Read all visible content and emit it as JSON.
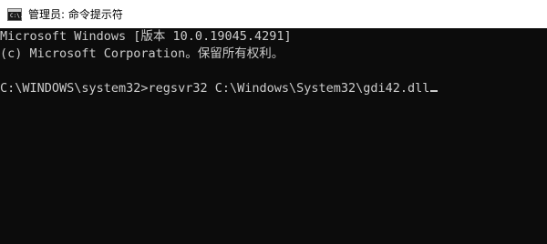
{
  "window": {
    "title": "管理员: 命令提示符",
    "icon": "cmd-console-icon",
    "icon_text": "C:\\."
  },
  "console": {
    "lines": [
      "Microsoft Windows [版本 10.0.19045.4291]",
      "(c) Microsoft Corporation。保留所有权利。",
      "",
      "C:\\WINDOWS\\system32>regsvr32 C:\\Windows\\System32\\gdi42.dll"
    ],
    "background": "#0c0c0c",
    "foreground": "#cccccc"
  }
}
